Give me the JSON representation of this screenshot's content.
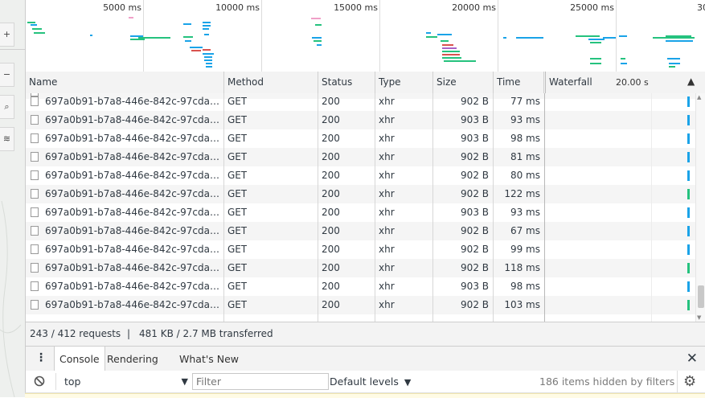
{
  "overview": {
    "ticks": [
      "5000 ms",
      "10000 ms",
      "15000 ms",
      "20000 ms",
      "25000 ms",
      "30"
    ],
    "colors": {
      "blue": "#1aa3e8",
      "green": "#25c27e",
      "red": "#d9534f",
      "purple": "#a862c9",
      "pink": "#f0a0c8"
    }
  },
  "columns": {
    "name": "Name",
    "method": "Method",
    "status": "Status",
    "type": "Type",
    "size": "Size",
    "time": "Time",
    "waterfall": "Waterfall",
    "waterfall_time": "20.00 s"
  },
  "requests": [
    {
      "name": "697a0b91-b7a8-446e-842c-97cda…",
      "method": "GET",
      "status": "200",
      "type": "xhr",
      "size": "902 B",
      "time": "77 ms",
      "bar_color": "#1aa3e8"
    },
    {
      "name": "697a0b91-b7a8-446e-842c-97cda…",
      "method": "GET",
      "status": "200",
      "type": "xhr",
      "size": "903 B",
      "time": "93 ms",
      "bar_color": "#1aa3e8"
    },
    {
      "name": "697a0b91-b7a8-446e-842c-97cda…",
      "method": "GET",
      "status": "200",
      "type": "xhr",
      "size": "903 B",
      "time": "98 ms",
      "bar_color": "#1aa3e8"
    },
    {
      "name": "697a0b91-b7a8-446e-842c-97cda…",
      "method": "GET",
      "status": "200",
      "type": "xhr",
      "size": "902 B",
      "time": "81 ms",
      "bar_color": "#1aa3e8"
    },
    {
      "name": "697a0b91-b7a8-446e-842c-97cda…",
      "method": "GET",
      "status": "200",
      "type": "xhr",
      "size": "902 B",
      "time": "80 ms",
      "bar_color": "#1aa3e8"
    },
    {
      "name": "697a0b91-b7a8-446e-842c-97cda…",
      "method": "GET",
      "status": "200",
      "type": "xhr",
      "size": "902 B",
      "time": "122 ms",
      "bar_color": "#25c27e"
    },
    {
      "name": "697a0b91-b7a8-446e-842c-97cda…",
      "method": "GET",
      "status": "200",
      "type": "xhr",
      "size": "903 B",
      "time": "93 ms",
      "bar_color": "#1aa3e8"
    },
    {
      "name": "697a0b91-b7a8-446e-842c-97cda…",
      "method": "GET",
      "status": "200",
      "type": "xhr",
      "size": "902 B",
      "time": "67 ms",
      "bar_color": "#1aa3e8"
    },
    {
      "name": "697a0b91-b7a8-446e-842c-97cda…",
      "method": "GET",
      "status": "200",
      "type": "xhr",
      "size": "902 B",
      "time": "99 ms",
      "bar_color": "#1aa3e8"
    },
    {
      "name": "697a0b91-b7a8-446e-842c-97cda…",
      "method": "GET",
      "status": "200",
      "type": "xhr",
      "size": "902 B",
      "time": "118 ms",
      "bar_color": "#25c27e"
    },
    {
      "name": "697a0b91-b7a8-446e-842c-97cda…",
      "method": "GET",
      "status": "200",
      "type": "xhr",
      "size": "903 B",
      "time": "98 ms",
      "bar_color": "#1aa3e8"
    },
    {
      "name": "697a0b91-b7a8-446e-842c-97cda…",
      "method": "GET",
      "status": "200",
      "type": "xhr",
      "size": "902 B",
      "time": "103 ms",
      "bar_color": "#25c27e"
    }
  ],
  "summary": {
    "requests": "243 / 412 requests",
    "separator": "|",
    "transferred": "481 KB / 2.7 MB transferred"
  },
  "drawer": {
    "tabs": [
      "Console",
      "Rendering",
      "What's New"
    ],
    "active_tab": "Console"
  },
  "console": {
    "context": "top",
    "filter_placeholder": "Filter",
    "levels": "Default levels",
    "hidden": "186 items hidden by filters"
  }
}
